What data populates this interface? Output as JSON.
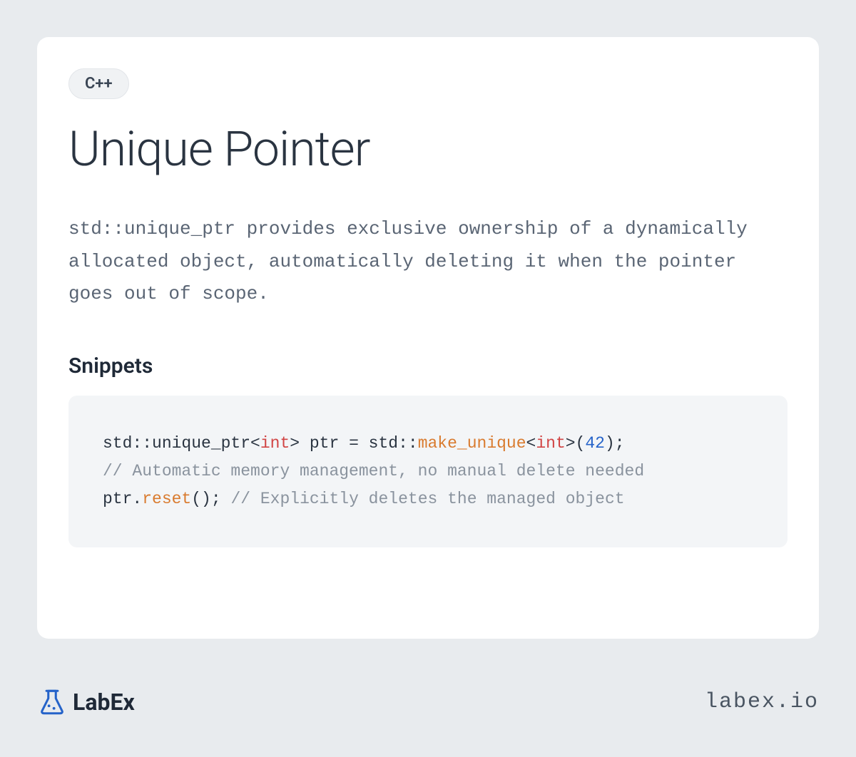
{
  "card": {
    "tag": "C++",
    "title": "Unique Pointer",
    "description": "std::unique_ptr provides exclusive ownership of a dynamically allocated object, automatically deleting it when the pointer goes out of scope.",
    "snippets_heading": "Snippets",
    "code": {
      "line1": {
        "part1": "std::unique_ptr<",
        "keyword1": "int",
        "part2": "> ptr = std::",
        "function1": "make_unique",
        "part3": "<",
        "keyword2": "int",
        "part4": ">(",
        "number1": "42",
        "part5": ");"
      },
      "line2": {
        "comment": "// Automatic memory management, no manual delete needed"
      },
      "line3": {
        "part1": "ptr.",
        "function1": "reset",
        "part2": "(); ",
        "comment": "// Explicitly deletes the managed object"
      }
    }
  },
  "footer": {
    "logo_text": "LabEx",
    "site_url": "labex.io"
  }
}
